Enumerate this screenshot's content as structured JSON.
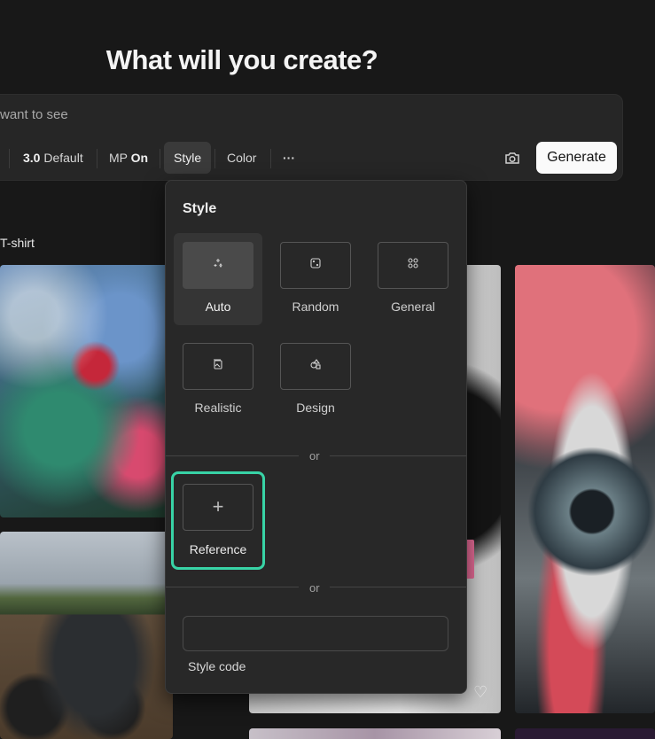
{
  "headline": "What will you create?",
  "prompt": {
    "value": "want to see"
  },
  "toolbar": {
    "version_value": "3.0",
    "version_label": "Default",
    "mp_label": "MP",
    "mp_value": "On",
    "style_label": "Style",
    "color_label": "Color",
    "more_label": "···",
    "generate_label": "Generate"
  },
  "gallery": {
    "caption": "T-shirt"
  },
  "style_panel": {
    "title": "Style",
    "options": [
      {
        "label": "Auto",
        "icon": "sparkles-icon",
        "selected": true
      },
      {
        "label": "Random",
        "icon": "dice-icon",
        "selected": false
      },
      {
        "label": "General",
        "icon": "grid-icon",
        "selected": false
      },
      {
        "label": "Realistic",
        "icon": "photo-stack-icon",
        "selected": false
      },
      {
        "label": "Design",
        "icon": "shapes-icon",
        "selected": false
      }
    ],
    "or_label": "or",
    "reference_label": "Reference",
    "reference_plus": "+",
    "style_code_label": "Style code",
    "style_code_value": ""
  },
  "colors": {
    "accent": "#38d3a6",
    "panel": "#282828",
    "generate_bg": "#fafafa"
  }
}
